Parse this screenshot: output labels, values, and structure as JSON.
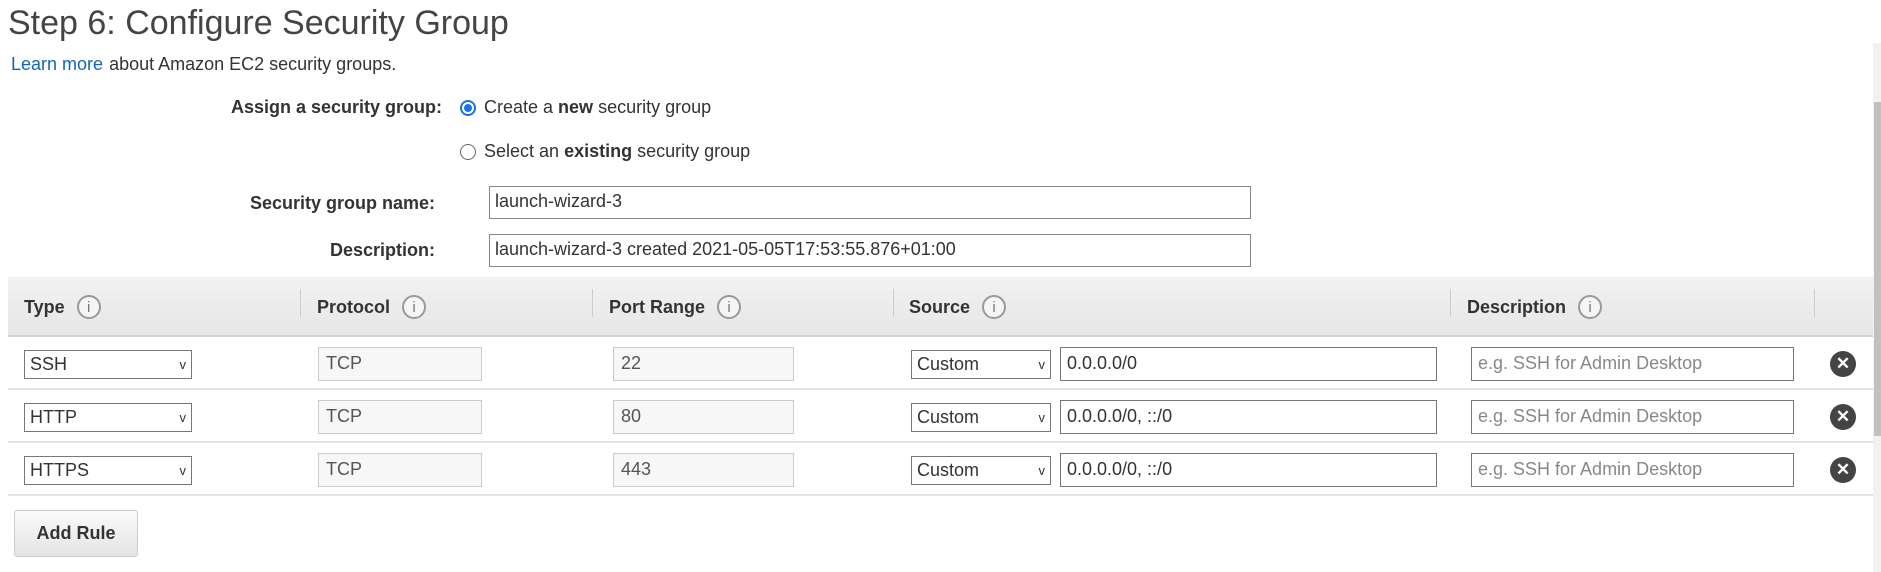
{
  "title": "Step 6: Configure Security Group",
  "learn_more": {
    "link": "Learn more",
    "text": "about Amazon EC2 security groups."
  },
  "assign": {
    "label": "Assign a security group:",
    "options": [
      {
        "pre": "Create a ",
        "bold": "new",
        "post": " security group",
        "selected": true
      },
      {
        "pre": "Select an ",
        "bold": "existing",
        "post": " security group",
        "selected": false
      }
    ]
  },
  "sg_name": {
    "label": "Security group name:",
    "value": "launch-wizard-3"
  },
  "description": {
    "label": "Description:",
    "value": "launch-wizard-3 created 2021-05-05T17:53:55.876+01:00"
  },
  "table": {
    "headers": [
      "Type",
      "Protocol",
      "Port Range",
      "Source",
      "Description"
    ],
    "info_icon": "i",
    "rows": [
      {
        "type": "SSH",
        "protocol": "TCP",
        "port": "22",
        "source_type": "Custom",
        "source": "0.0.0.0/0",
        "desc_placeholder": "e.g. SSH for Admin Desktop"
      },
      {
        "type": "HTTP",
        "protocol": "TCP",
        "port": "80",
        "source_type": "Custom",
        "source": "0.0.0.0/0, ::/0",
        "desc_placeholder": "e.g. SSH for Admin Desktop"
      },
      {
        "type": "HTTPS",
        "protocol": "TCP",
        "port": "443",
        "source_type": "Custom",
        "source": "0.0.0.0/0, ::/0",
        "desc_placeholder": "e.g. SSH for Admin Desktop"
      }
    ]
  },
  "add_rule": "Add Rule",
  "icons": {
    "remove": "✕",
    "chevron": "v"
  },
  "colors": {
    "link": "#1166bb",
    "radio_accent": "#1a73e8"
  }
}
